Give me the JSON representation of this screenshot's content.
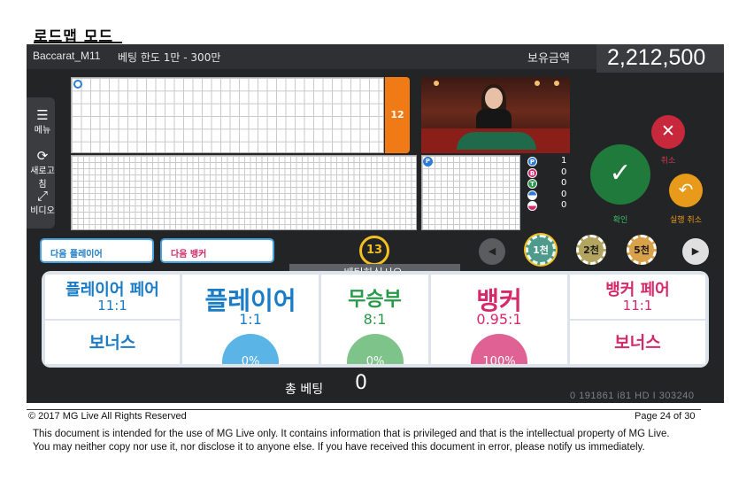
{
  "doc": {
    "title": "로드맵 모드",
    "copyright": "© 2017 MG Live   All Rights Reserved",
    "page": "Page 24 of 30",
    "notice": "This document is intended for the use of MG Live only. It contains information that is privileged and that is the intellectual property of MG Live.  You may neither copy nor use it, nor disclose it to anyone else. If you have received this document in error, please notify us immediately."
  },
  "header": {
    "table_name": "Baccarat_M11",
    "bet_limit": "베팅 한도 1만 - 300만",
    "balance_label": "보유금액",
    "balance_value": "2,212,500"
  },
  "sidebar": {
    "items": [
      {
        "icon": "menu-icon",
        "label": "메뉴"
      },
      {
        "icon": "refresh-icon",
        "label": "새로고침"
      },
      {
        "icon": "expand-icon",
        "label": "비디오"
      }
    ]
  },
  "roadmap": {
    "main_count": "12",
    "big_road_marker": "P"
  },
  "stats": [
    {
      "icon": "player-icon",
      "letter": "P",
      "color": "#2d7bd6",
      "value": "1"
    },
    {
      "icon": "banker-icon",
      "letter": "B",
      "color": "#d42a6a",
      "value": "0"
    },
    {
      "icon": "tie-icon",
      "letter": "T",
      "color": "#2a9a4a",
      "value": "0"
    },
    {
      "icon": "player-pair-icon",
      "letter": "",
      "color": "#2d7bd6",
      "value": "0"
    },
    {
      "icon": "banker-pair-icon",
      "letter": "",
      "color": "#d42a6a",
      "value": "0"
    }
  ],
  "actions": {
    "confirm": "확인",
    "cancel": "취소",
    "undo": "실행 취소"
  },
  "next": {
    "player": "다음 플레이어",
    "banker": "다음 뱅커"
  },
  "timer": {
    "seconds": "13",
    "message": "베팅하십시오."
  },
  "chips": [
    {
      "label": "1천",
      "selected": true
    },
    {
      "label": "2천",
      "selected": false
    },
    {
      "label": "5천",
      "selected": false
    }
  ],
  "bets": {
    "player_pair": {
      "title": "플레이어 페어",
      "odds": "11:1"
    },
    "player_bonus": {
      "title": "보너스"
    },
    "player": {
      "title": "플레이어",
      "odds": "1:1",
      "percent": "0%"
    },
    "tie": {
      "title": "무승부",
      "odds": "8:1",
      "percent": "0%"
    },
    "banker": {
      "title": "뱅커",
      "odds": "0.95:1",
      "percent": "100%"
    },
    "banker_pair": {
      "title": "뱅커 페어",
      "odds": "11:1"
    },
    "banker_bonus": {
      "title": "보너스"
    }
  },
  "footer": {
    "total_label": "총 베팅",
    "total_value": "0",
    "code": "0  191861  i81  HD  I  303240"
  },
  "colors": {
    "player": "#1a7cc6",
    "banker": "#d42a6a",
    "tie": "#2a9a4a",
    "background": "#222426"
  }
}
